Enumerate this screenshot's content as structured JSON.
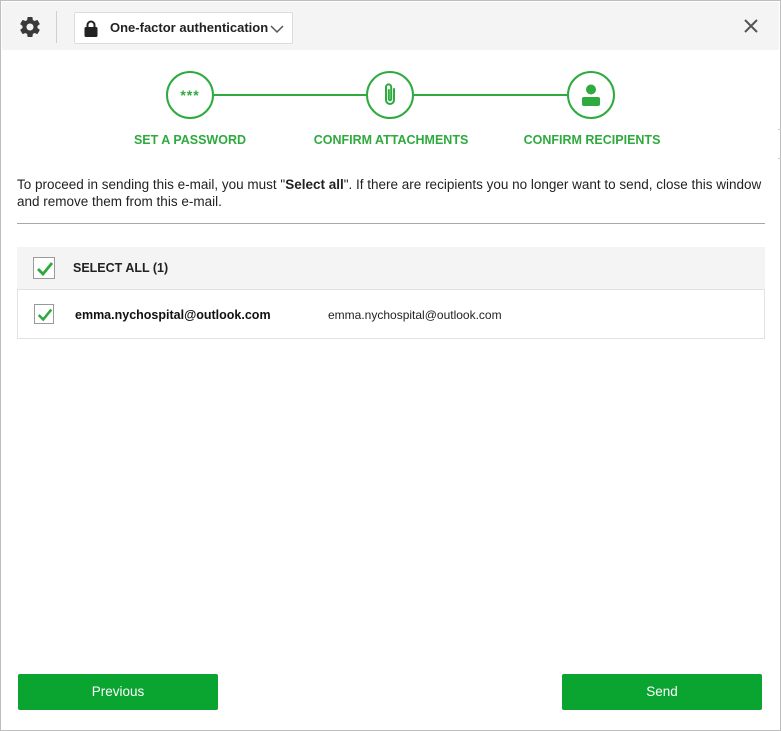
{
  "header": {
    "auth_mode": "One-factor authentication",
    "icons": [
      "gear-icon",
      "lock-icon",
      "chevron-down-icon",
      "close-icon"
    ]
  },
  "steps": [
    {
      "label": "SET A PASSWORD",
      "marker": "***",
      "icon": "password-icon"
    },
    {
      "label": "CONFIRM ATTACHMENTS",
      "icon": "paperclip-icon"
    },
    {
      "label": "CONFIRM RECIPIENTS",
      "icon": "user-icon"
    }
  ],
  "instruction": {
    "before": "To proceed in sending this e-mail, you must \"",
    "emphasis": "Select all",
    "after": "\". If there are recipients you no longer want to send, close this window and remove them from this e-mail."
  },
  "recipients": {
    "select_all_label": "SELECT ALL (1)",
    "select_all_checked": true,
    "rows": [
      {
        "email": "emma.nychospital@outlook.com",
        "name": "emma.nychospital@outlook.com",
        "checked": true
      }
    ]
  },
  "buttons": {
    "previous": "Previous",
    "send": "Send"
  },
  "colors": {
    "accent": "#2eaa3e",
    "button": "#0aa531",
    "topbar": "#f4f4f4"
  }
}
